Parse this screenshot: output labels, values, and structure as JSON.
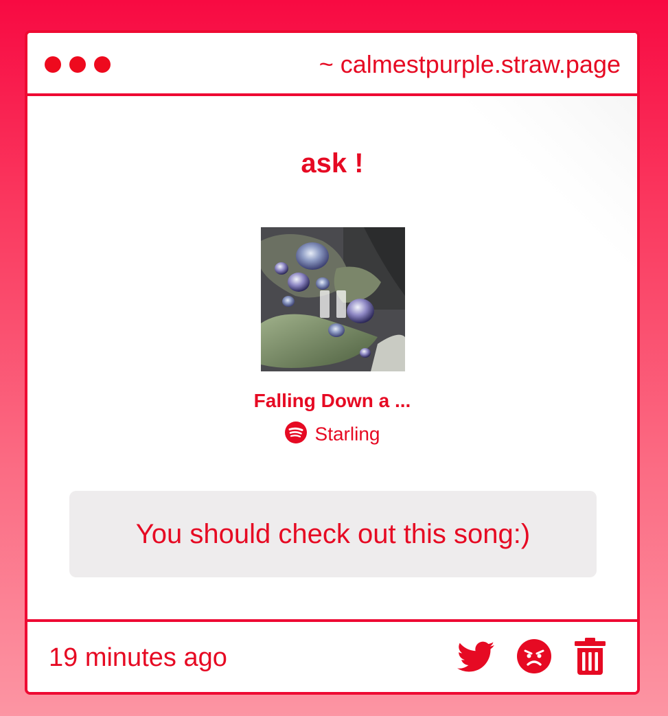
{
  "window": {
    "url": "~ calmestpurple.straw.page",
    "controls": [
      "red-dot",
      "red-dot",
      "red-dot"
    ]
  },
  "page": {
    "title": "ask !"
  },
  "track": {
    "title": "Falling Down a ...",
    "artist": "Starling",
    "service_icon": "spotify-icon",
    "playback_icon": "pause-icon"
  },
  "message": {
    "text": "You should check out this song:)"
  },
  "footer": {
    "timestamp": "19 minutes ago",
    "actions": [
      "twitter-icon",
      "angry-face-icon",
      "trash-icon"
    ]
  },
  "colors": {
    "accent": "#e60a23",
    "border": "#ee0a33",
    "message_bg": "#eeeced",
    "background_top": "#f80a42",
    "background_bottom": "#fc95a3"
  }
}
